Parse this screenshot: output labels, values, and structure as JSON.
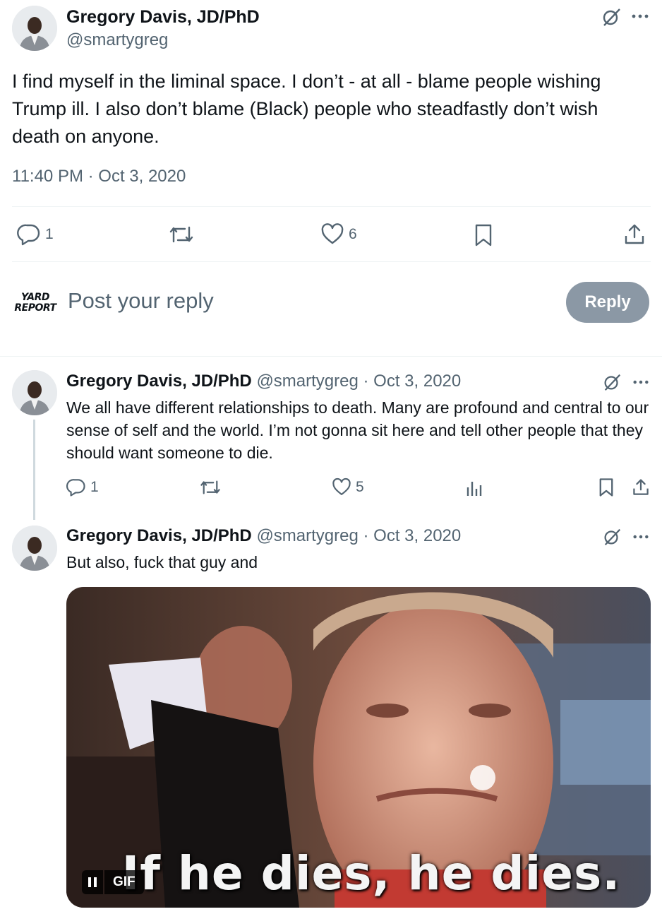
{
  "main_tweet": {
    "display_name": "Gregory Davis, JD/PhD",
    "handle": "@smartygreg",
    "text": "I find myself in the liminal space. I don’t - at all - blame people wishing Trump ill. I also don’t blame (Black) people who steadfastly don’t wish death on anyone.",
    "timestamp": "11:40 PM · Oct 3, 2020",
    "reply_count": "1",
    "like_count": "6",
    "icons": [
      "grok-icon",
      "more-icon",
      "reply-icon",
      "retweet-icon",
      "like-icon",
      "bookmark-icon",
      "share-icon"
    ]
  },
  "composer": {
    "logo_text_1": "YARD",
    "logo_text_2": "REPORT",
    "placeholder": "Post your reply",
    "reply_button": "Reply"
  },
  "thread": [
    {
      "display_name": "Gregory Davis, JD/PhD",
      "handle": "@smartygreg",
      "date": "· Oct 3, 2020",
      "text": "We all have different relationships to death. Many are profound and central to our sense of self and the world. I’m not gonna sit here and tell other people that they should want someone to die.",
      "reply_count": "1",
      "like_count": "5"
    },
    {
      "display_name": "Gregory Davis, JD/PhD",
      "handle": "@smartygreg",
      "date": "· Oct 3, 2020",
      "text": "But also, fuck that guy and",
      "gif_caption": "If he dies, he dies.",
      "gif_label": "GIF"
    }
  ],
  "colors": {
    "text": "#0f1419",
    "muted": "#536471",
    "reply_button": "#8b98a5",
    "divider": "#eff3f4"
  }
}
